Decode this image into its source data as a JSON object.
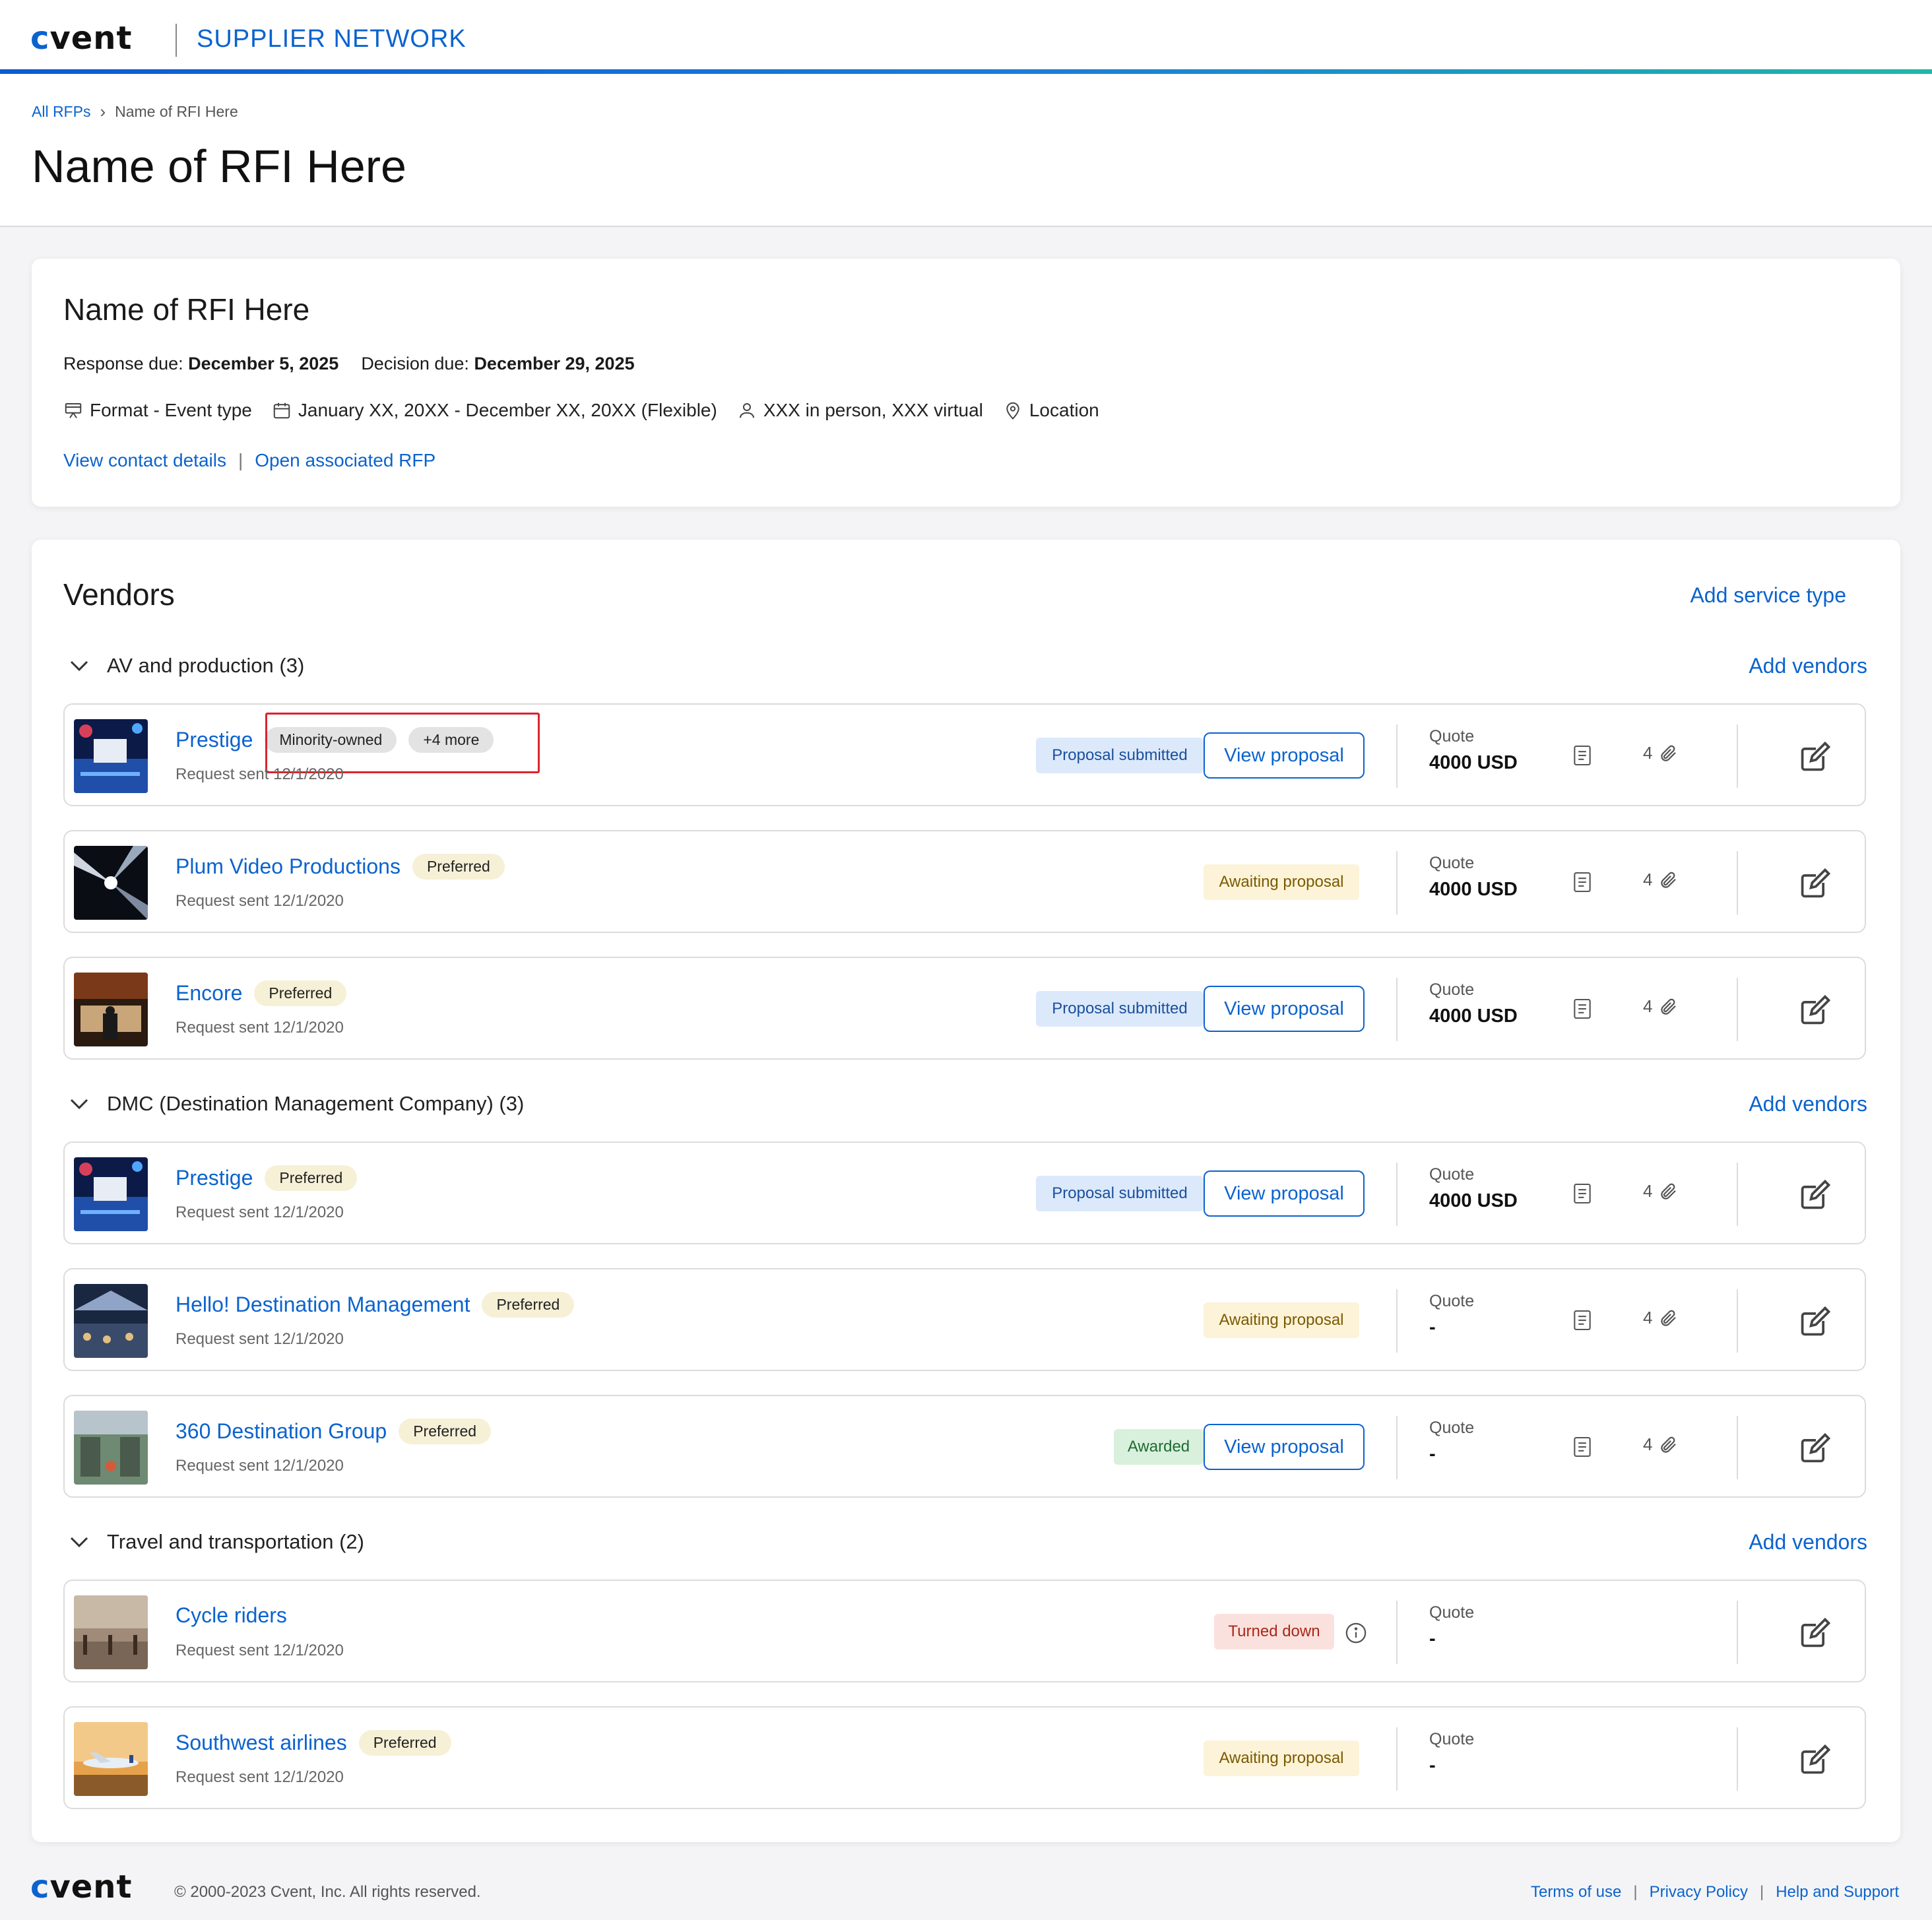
{
  "brand": {
    "logo": "cvent",
    "network": "SUPPLIER NETWORK"
  },
  "breadcrumb": {
    "root": "All RFPs",
    "current": "Name of RFI Here"
  },
  "page_title": "Name of RFI Here",
  "rfi": {
    "title": "Name of RFI Here",
    "response_label": "Response due:",
    "response_date": "December 5, 2025",
    "decision_label": "Decision due:",
    "decision_date": "December 29, 2025",
    "format": "Format - Event type",
    "dates": "January XX, 20XX - December XX, 20XX (Flexible)",
    "attendees": "XXX in person, XXX virtual",
    "location": "Location",
    "contact_link": "View contact details",
    "rfp_link": "Open associated RFP"
  },
  "vendors": {
    "title": "Vendors",
    "add_service": "Add service type",
    "add_vendors": "Add vendors",
    "quote_label": "Quote",
    "view_proposal": "View proposal",
    "sections": [
      {
        "title": "AV and production (3)"
      },
      {
        "title": "DMC (Destination Management Company) (3)"
      },
      {
        "title": "Travel and transportation (2)"
      }
    ],
    "rows": [
      {
        "name": "Prestige",
        "tags": [
          "Minority-owned",
          "+4 more"
        ],
        "sent": "Request sent 12/1/2020",
        "status": "Proposal submitted",
        "quote": "4000 USD",
        "attachments": "4"
      },
      {
        "name": "Plum Video Productions",
        "tags": [
          "Preferred"
        ],
        "sent": "Request sent 12/1/2020",
        "status": "Awaiting proposal",
        "quote": "4000 USD",
        "attachments": "4"
      },
      {
        "name": "Encore",
        "tags": [
          "Preferred"
        ],
        "sent": "Request sent 12/1/2020",
        "status": "Proposal submitted",
        "quote": "4000 USD",
        "attachments": "4"
      },
      {
        "name": "Prestige",
        "tags": [
          "Preferred"
        ],
        "sent": "Request sent 12/1/2020",
        "status": "Proposal submitted",
        "quote": "4000 USD",
        "attachments": "4"
      },
      {
        "name": "Hello! Destination Management",
        "tags": [
          "Preferred"
        ],
        "sent": "Request sent 12/1/2020",
        "status": "Awaiting proposal",
        "quote": "-",
        "attachments": "4"
      },
      {
        "name": "360 Destination Group",
        "tags": [
          "Preferred"
        ],
        "sent": "Request sent 12/1/2020",
        "status": "Awarded",
        "quote": "-",
        "attachments": "4"
      },
      {
        "name": "Cycle riders",
        "tags": [],
        "sent": "Request sent 12/1/2020",
        "status": "Turned down",
        "quote": "-"
      },
      {
        "name": "Southwest airlines",
        "tags": [
          "Preferred"
        ],
        "sent": "Request sent 12/1/2020",
        "status": "Awaiting proposal",
        "quote": "-"
      }
    ]
  },
  "footer": {
    "copyright": "© 2000-2023 Cvent, Inc. All rights reserved.",
    "terms": "Terms of use",
    "privacy": "Privacy Policy",
    "help": "Help and Support"
  },
  "colors": {
    "link": "#0b63ce",
    "highlight": "#d8252e"
  }
}
